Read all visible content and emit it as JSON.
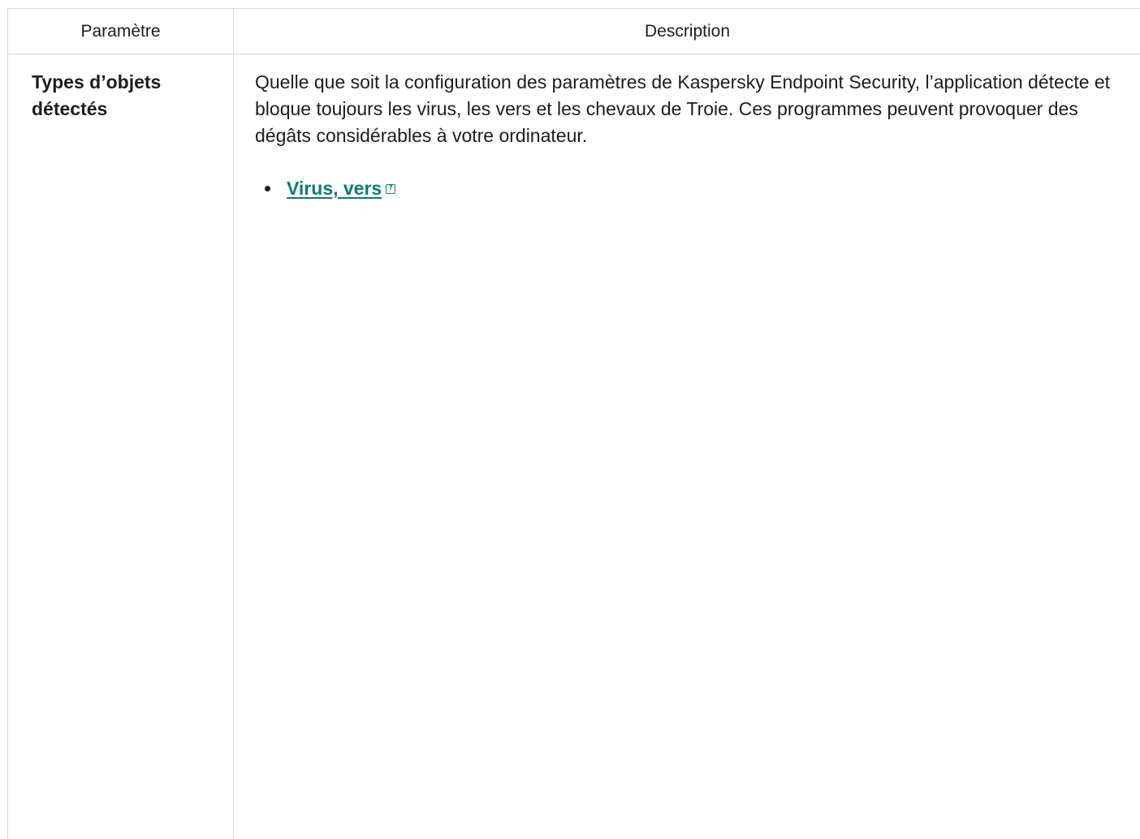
{
  "table": {
    "headers": {
      "parameter": "Paramètre",
      "description": "Description"
    },
    "rows": [
      {
        "parameter": "Types d’objets détectés",
        "description": "Quelle que soit la configuration des paramètres de Kaspersky Endpoint Security, l’application détecte et bloque toujours les virus, les vers et les chevaux de Troie. Ces programmes peuvent provoquer des dégâts considérables à votre ordinateur.",
        "items": [
          {
            "label": "Virus, vers",
            "icon": "help-tooltip-icon"
          }
        ]
      }
    ]
  },
  "colors": {
    "link": "#0a7f6a",
    "border": "#d7d7d7",
    "text": "#1d1d1b"
  }
}
